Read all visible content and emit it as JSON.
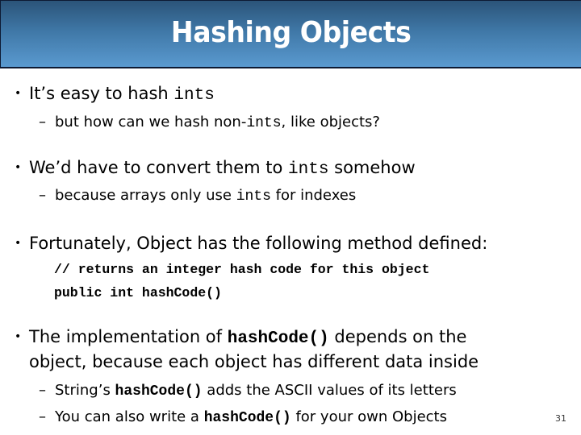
{
  "slide": {
    "title": "Hashing Objects",
    "slide_number": "31",
    "colors": {
      "title_gradient_top": "#2b5479",
      "title_gradient_bottom": "#5a9ad0",
      "title_border": "#0d1a33",
      "title_text": "#ffffff"
    }
  },
  "bullets": [
    {
      "text_before": "It’s easy to hash ",
      "code": "ints",
      "sub": [
        {
          "text_before": "but how can we hash non-",
          "code": "ints",
          "text_after": ", like objects?"
        }
      ]
    },
    {
      "text_before": "We’d have to convert them to ",
      "code": "ints",
      "text_after": " somehow",
      "sub": [
        {
          "text_before": "because arrays only use ",
          "code": "ints",
          "text_after": " for indexes"
        }
      ]
    },
    {
      "text": "Fortunately, Object has the following method defined:",
      "code_lines": [
        "// returns an integer hash code for this object",
        "public int hashCode()"
      ]
    },
    {
      "text_before": "The implementation of ",
      "code": "hashCode()",
      "text_after": " depends on the",
      "continuation": "object, because each object has different data inside",
      "sub": [
        {
          "text_before": "String’s ",
          "code": "hashCode()",
          "text_after": " adds the ASCII values of its letters"
        },
        {
          "text_before": "You can also write a ",
          "code": "hashCode()",
          "text_after": " for your own Objects"
        }
      ]
    }
  ],
  "glyphs": {
    "bullet": "•",
    "dash": "–"
  }
}
